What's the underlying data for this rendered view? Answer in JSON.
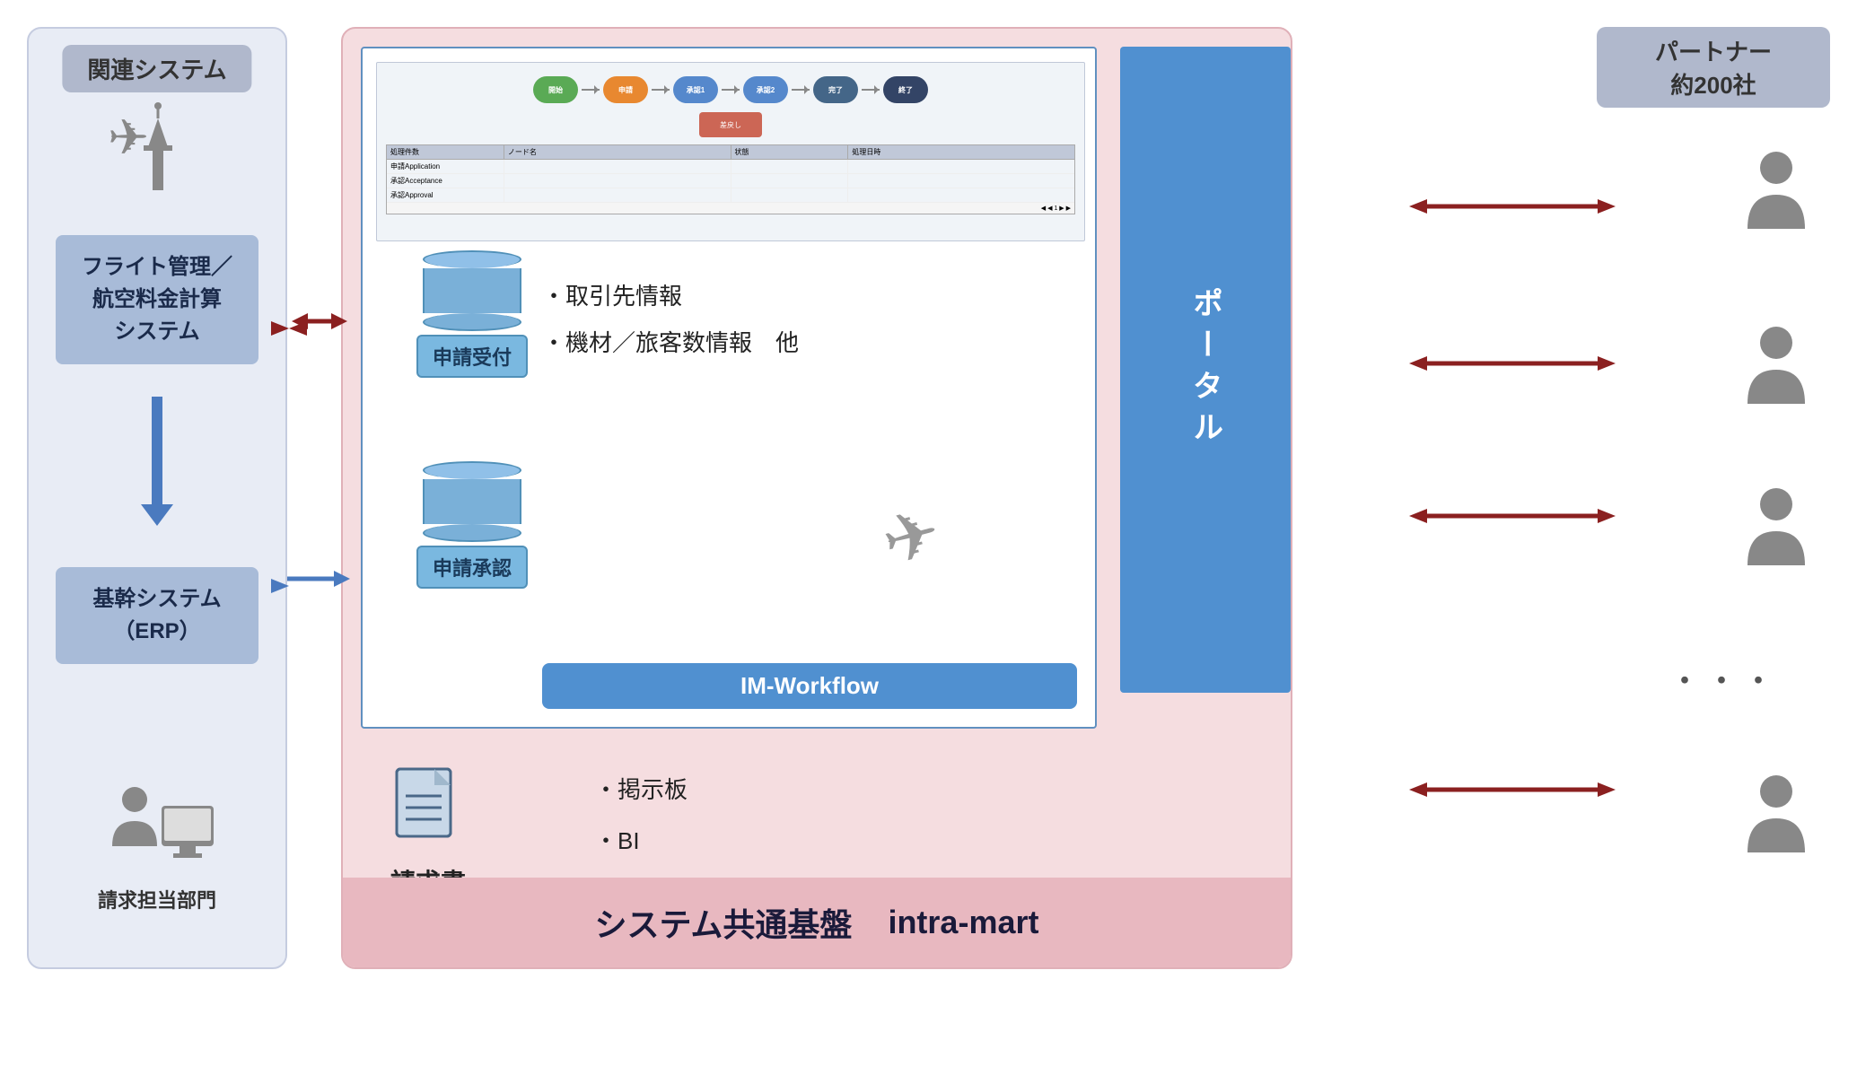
{
  "left": {
    "title": "関連システム",
    "flight_system": "フライト管理／\n航空料金計算\nシステム",
    "flight_line1": "フライト管理／",
    "flight_line2": "航空料金計算",
    "flight_line3": "システム",
    "erp_label": "基幹システム\n（ERP）",
    "erp_line1": "基幹システム",
    "erp_line2": "（ERP）",
    "billing_dept": "請求担当部門"
  },
  "center": {
    "application_receipt": "申請受付",
    "application_approval": "申請承認",
    "im_workflow": "IM-Workflow",
    "info_line1": "・取引先情報",
    "info_line2": "・機材／旅客数情報　他",
    "bulletin": "・掲示板",
    "bi": "・BI",
    "invoice": "請求書",
    "portal": "ポータル",
    "bottom_label1": "システム共通基盤",
    "bottom_label2": "intra-mart"
  },
  "right": {
    "title_line1": "パートナー",
    "title_line2": "約200社"
  },
  "icons": {
    "airplane_tower": "✈🗼",
    "airplane": "✈",
    "person": "👤",
    "document": "📄"
  }
}
